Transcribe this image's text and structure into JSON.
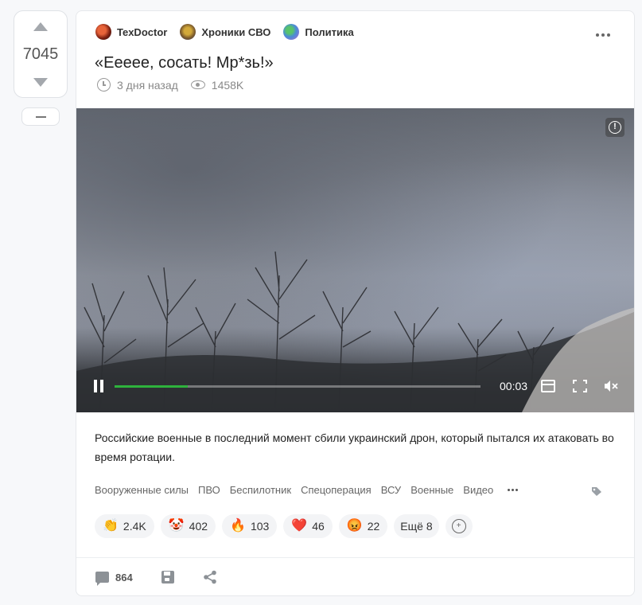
{
  "vote": {
    "count": "7045"
  },
  "communities": [
    {
      "name": "TexDoctor",
      "icon": "texdoctor-avatar"
    },
    {
      "name": "Хроники СВО",
      "icon": "chronicles-svo-avatar"
    },
    {
      "name": "Политика",
      "icon": "politics-avatar"
    }
  ],
  "post": {
    "title": "«Еееее, сосать! Мр*зь!»",
    "time_ago": "3 дня назад",
    "views": "1458K",
    "description": "Российские военные в последний момент сбили украинский дрон, который пытался их атаковать во время ротации."
  },
  "video": {
    "time": "00:03",
    "progress": 0.2,
    "accent_color": "#2eb23c"
  },
  "tags": [
    "Вооруженные силы",
    "ПВО",
    "Беспилотник",
    "Спецоперация",
    "ВСУ",
    "Военные",
    "Видео"
  ],
  "reactions": [
    {
      "emoji": "👏",
      "count": "2.4K"
    },
    {
      "emoji": "🤡",
      "count": "402"
    },
    {
      "emoji": "🔥",
      "count": "103"
    },
    {
      "emoji": "❤️",
      "count": "46"
    },
    {
      "emoji": "😡",
      "count": "22"
    }
  ],
  "reactions_more": "Ещё 8",
  "footer": {
    "comments": "864"
  }
}
